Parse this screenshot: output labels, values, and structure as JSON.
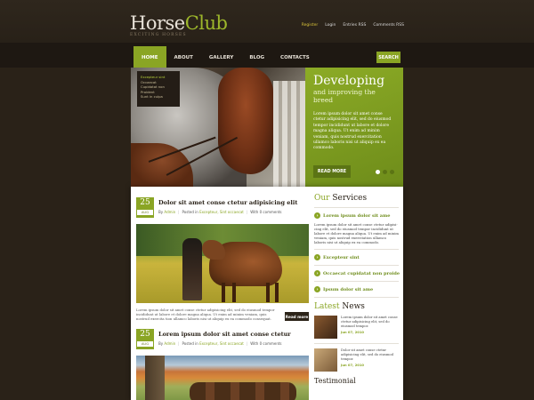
{
  "header": {
    "logo_part1": "Horse",
    "logo_part2": "Club",
    "tagline": "EXCITING HORSES",
    "links": [
      "Register",
      "Login",
      "Entries RSS",
      "Comments RSS"
    ]
  },
  "nav": {
    "items": [
      "HOME",
      "ABOUT",
      "GALLERY",
      "BLOG",
      "CONTACTS"
    ],
    "search_label": "SEARCH"
  },
  "dropdown": {
    "items": [
      "Excepteur sint",
      "Occaecat",
      "Cupidatat non",
      "Proident",
      "Sunt in culpa"
    ]
  },
  "slider": {
    "title": "Developing",
    "subtitle": "and improving the breed",
    "text": "Lorem ipsum dolor sit amet conse ctetur adipisicing elit, sed do eiusmod tempor incididunt ut labore et dolore magna aliqua. Ut enim ad minim veniam, quis nostrud exercitation ullamco laboris nisi ut aliquip ex ea commodo.",
    "button": "READ MORE"
  },
  "posts": [
    {
      "day": "25",
      "month": "AUG",
      "title": "Dolor sit amet conse ctetur adipisicing elit",
      "by": "By",
      "author": "Admin",
      "posted_in": "Posted in",
      "categories": "Excepteur, Sint occaecat",
      "comments_prefix": "With",
      "comments": "0 comments",
      "excerpt": "Lorem ipsum dolor sit amet conse ctetur adipisicing elit, sed do eiusmod tempor incididunt ut labore et dolore magna aliqua. Ut enim ad minim veniam, quis nostrud exercita tion ullamco laboris nisi ut aliquip ex ea commodo consequat.",
      "more": "Read more"
    },
    {
      "day": "25",
      "month": "AUG",
      "title": "Lorem ipsum dolor sit amet conse ctetur",
      "by": "By",
      "author": "Admin",
      "posted_in": "Posted in",
      "categories": "Excepteur, Sint occaecat",
      "comments_prefix": "With",
      "comments": "0 comments"
    }
  ],
  "sidebar": {
    "services_title_1": "Our",
    "services_title_2": "Services",
    "services": [
      {
        "title": "Lorem ipsum dolor sit ame",
        "text": "Lorem ipsum dolor sit amet conse ctetur adipisi-cing elit, sed do eiusmod tempor incididunt ut labore et dolore magna aliqua. Ut enim ad minim veniam, quis nostrud exercitation ullamco laboris nisi ut aliquip ex ea commodo."
      },
      {
        "title": "Excepteur sint"
      },
      {
        "title": "Occaecat cupidatat non proide"
      },
      {
        "title": "Ipsum dolor sit ame"
      }
    ],
    "news_title_1": "Latest",
    "news_title_2": "News",
    "news": [
      {
        "text": "Lorem ipsum dolor sit amet conse ctetur adipisicing elit, sed do eiusmod tempor.",
        "date": "Jun 07, 2010"
      },
      {
        "text": "Dolor sit amet conse ctetur adipisicing elit, sed do eiusmod tempor.",
        "date": "Jun 07, 2010"
      }
    ],
    "testimonial_title": "Testimonial"
  },
  "colors": {
    "accent": "#8aa524",
    "background": "#2a2218"
  }
}
